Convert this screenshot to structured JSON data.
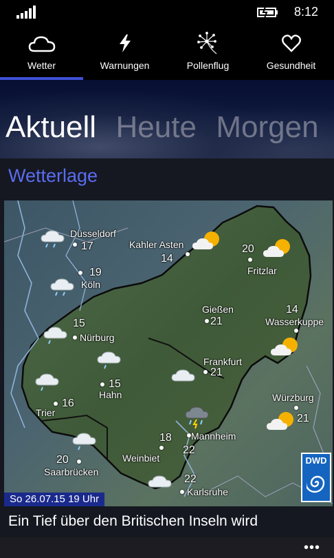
{
  "status_bar": {
    "time": "8:12"
  },
  "nav": {
    "items": [
      {
        "label": "Wetter",
        "icon": "cloud-icon",
        "active": true
      },
      {
        "label": "Warnungen",
        "icon": "lightning-icon"
      },
      {
        "label": "Pollenflug",
        "icon": "dandelion-icon"
      },
      {
        "label": "Gesundheit",
        "icon": "heart-icon"
      }
    ]
  },
  "tabs": [
    {
      "label": "Aktuell",
      "active": true
    },
    {
      "label": "Heute"
    },
    {
      "label": "Morgen"
    }
  ],
  "section_title": "Wetterlage",
  "map": {
    "locations": [
      {
        "name": "Düsseldorf",
        "temp": "17"
      },
      {
        "name": "Kahler Asten",
        "temp": "14"
      },
      {
        "name": "Fritzlar",
        "temp": "20"
      },
      {
        "name": "Köln",
        "temp": "19"
      },
      {
        "name": "Gießen",
        "temp": "21"
      },
      {
        "name": "Wasserkuppe",
        "temp": "14"
      },
      {
        "name": "Nürburg",
        "temp": "15"
      },
      {
        "name": "Frankfurt",
        "temp": "21"
      },
      {
        "name": "Hahn",
        "temp": "15"
      },
      {
        "name": "Trier",
        "temp": "16"
      },
      {
        "name": "Würzburg",
        "temp": "21"
      },
      {
        "name": "Weinbiet",
        "temp": "18"
      },
      {
        "name": "Mannheim",
        "temp": "22"
      },
      {
        "name": "Saarbrücken",
        "temp": "20"
      },
      {
        "name": "Karlsruhe",
        "temp": "22"
      }
    ],
    "timestamp": "So 26.07.15 19 Uhr",
    "logo": "DWD"
  },
  "description": "Ein Tief über den Britischen Inseln wird",
  "app_bar": {
    "more_label": "•••"
  }
}
